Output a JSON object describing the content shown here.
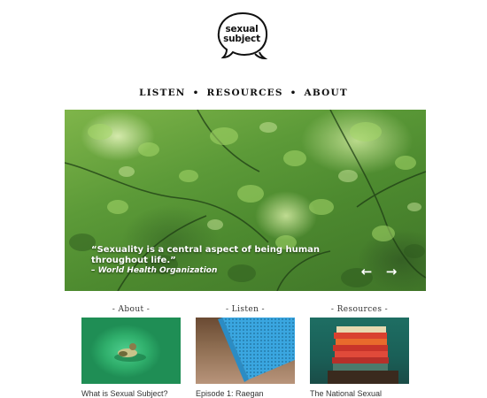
{
  "site": {
    "logo_line1": "sexual",
    "logo_line2": "subject"
  },
  "nav": {
    "items": [
      {
        "label": "LISTEN"
      },
      {
        "label": "RESOURCES"
      },
      {
        "label": "ABOUT"
      }
    ],
    "separator": "•"
  },
  "hero": {
    "quote": "“Sexuality is a central aspect of being human throughout life.”",
    "attribution": "– World Health Organization",
    "prev_icon": "arrow-left-icon",
    "next_icon": "arrow-right-icon",
    "prev_glyph": "←",
    "next_glyph": "→"
  },
  "cards": [
    {
      "category": "- About -",
      "caption": "What is Sexual Subject?"
    },
    {
      "category": "- Listen -",
      "caption": "Episode 1: Raegan"
    },
    {
      "category": "- Resources -",
      "caption": "The National Sexual"
    }
  ],
  "colors": {
    "text": "#111111",
    "hero_green": "#5c9a38",
    "about_thumb": "#2fae6b",
    "listen_speaker": "#3aa6e0",
    "resources_bg": "#1a5f57"
  }
}
